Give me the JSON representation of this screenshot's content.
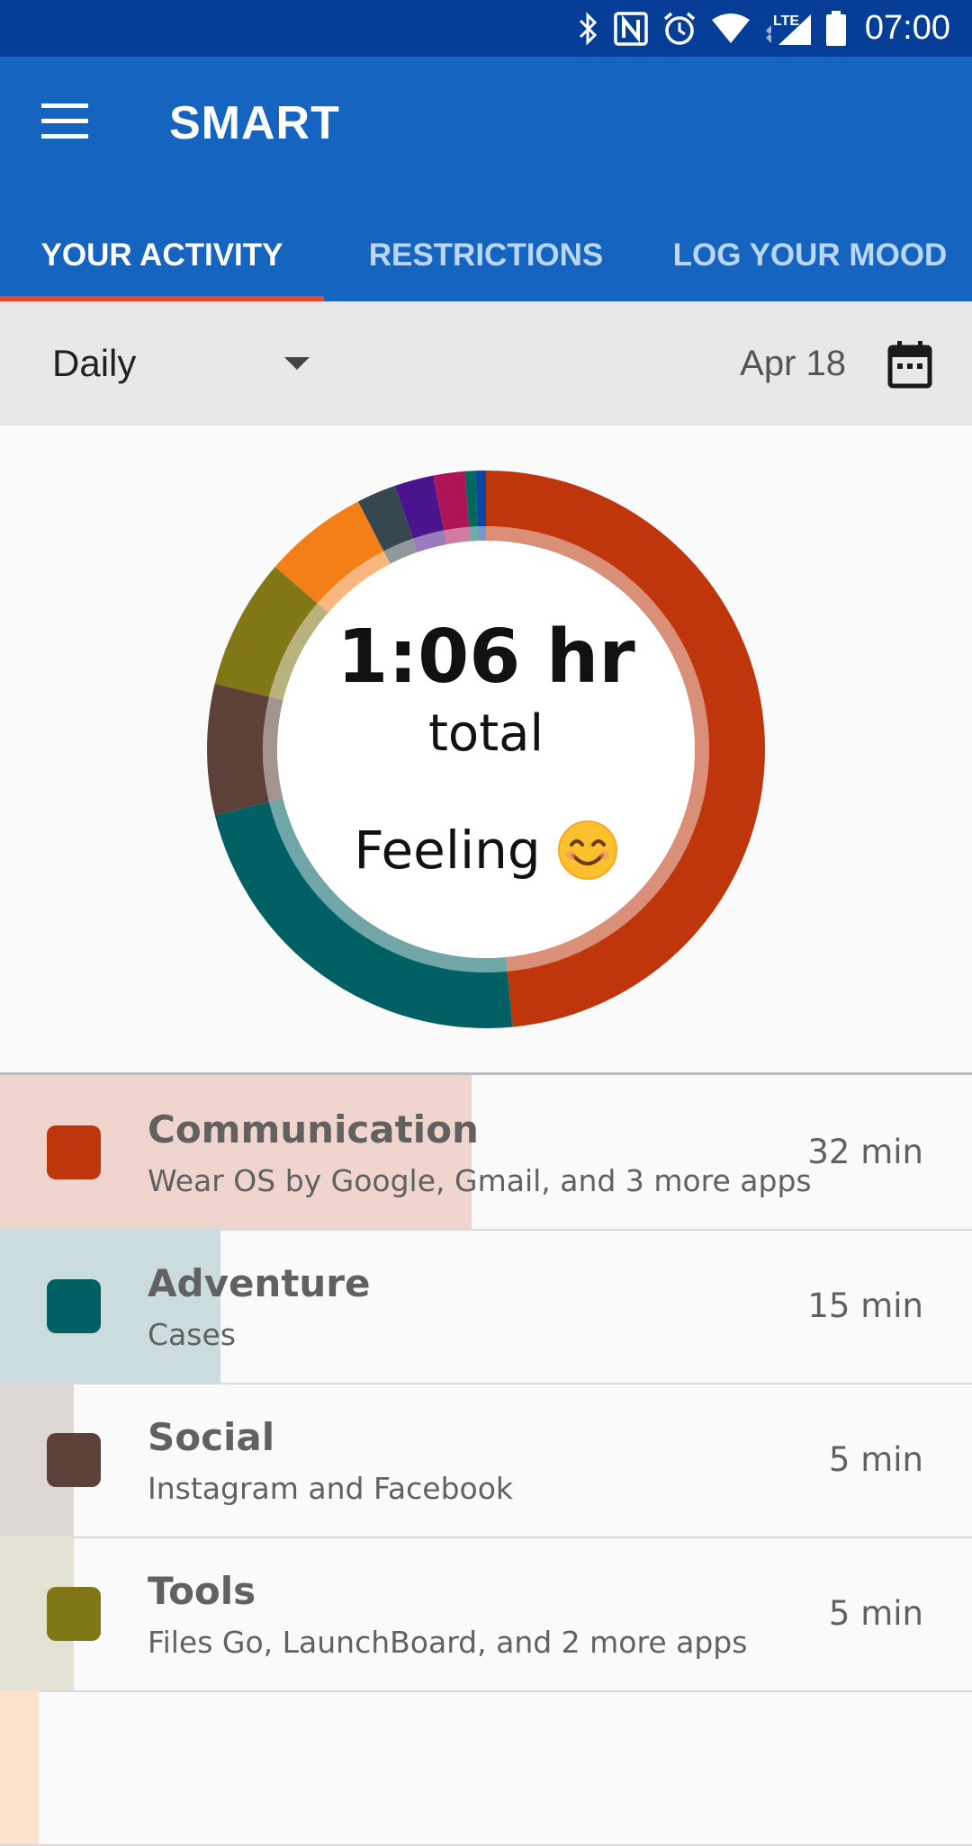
{
  "status_bar": {
    "time": "07:00",
    "icons": [
      "bluetooth-icon",
      "nfc-icon",
      "alarm-icon",
      "wifi-icon",
      "lte-icon",
      "signal-icon",
      "battery-icon"
    ],
    "lte_label": "LTE"
  },
  "app_bar": {
    "title": "SMART",
    "menu_icon": "hamburger-menu-icon",
    "background": "#1565c0"
  },
  "tabs": [
    {
      "label": "YOUR ACTIVITY",
      "active": true
    },
    {
      "label": "RESTRICTIONS",
      "active": false
    },
    {
      "label": "LOG YOUR MOOD",
      "active": false
    }
  ],
  "filter": {
    "period": "Daily",
    "date": "Apr 18",
    "calendar_icon": "calendar-icon"
  },
  "summary": {
    "total_value": "1:06 hr",
    "total_label": "total",
    "feeling_label": "Feeling",
    "feeling_emoji": "smiling-face-icon"
  },
  "chart_data": {
    "type": "pie",
    "subtype": "donut",
    "unit": "min",
    "slices": [
      {
        "label": "Communication",
        "value": 32,
        "color": "#bf360c"
      },
      {
        "label": "Adventure",
        "value": 15,
        "color": "#006064"
      },
      {
        "label": "Social",
        "value": 5,
        "color": "#5d4037"
      },
      {
        "label": "Tools",
        "value": 5,
        "color": "#827717"
      },
      {
        "label": "",
        "value": 4,
        "color": "#f57f17"
      },
      {
        "label": "",
        "value": 1.5,
        "color": "#37474f"
      },
      {
        "label": "",
        "value": 1.5,
        "color": "#4a148c"
      },
      {
        "label": "",
        "value": 1.2,
        "color": "#ad1457"
      },
      {
        "label": "",
        "value": 0.4,
        "color": "#00695c"
      },
      {
        "label": "",
        "value": 0.4,
        "color": "#0d47a1"
      }
    ]
  },
  "categories": [
    {
      "name": "Communication",
      "apps": "Wear OS by Google, Gmail, and 3 more apps",
      "duration": "32 min",
      "color": "#bf360c",
      "bar_color": "#f0d4ce",
      "fraction": 0.485
    },
    {
      "name": "Adventure",
      "apps": "Cases",
      "duration": "15 min",
      "color": "#006064",
      "bar_color": "#cadcdd",
      "fraction": 0.227
    },
    {
      "name": "Social",
      "apps": "Instagram and Facebook",
      "duration": "5 min",
      "color": "#5d4037",
      "bar_color": "#ddd7d5",
      "fraction": 0.076
    },
    {
      "name": "Tools",
      "apps": "Files Go, LaunchBoard, and 2 more apps",
      "duration": "5 min",
      "color": "#827717",
      "bar_color": "#e4e3d3",
      "fraction": 0.076
    },
    {
      "name": "",
      "apps": "",
      "duration": "",
      "color": "#f57f17",
      "bar_color": "#fde3cc",
      "fraction": 0.04
    }
  ]
}
